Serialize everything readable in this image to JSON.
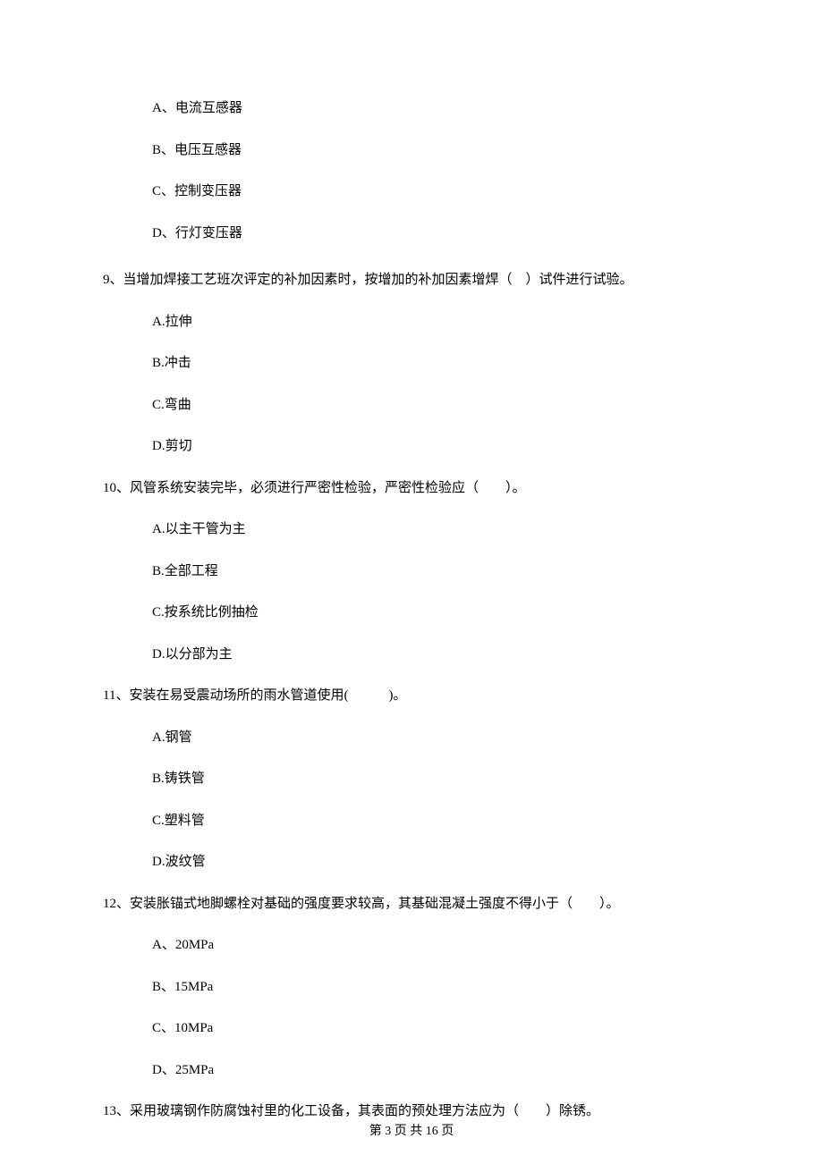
{
  "options_block1": {
    "a": "A、电流互感器",
    "b": "B、电压互感器",
    "c": "C、控制变压器",
    "d": "D、行灯变压器"
  },
  "q9": {
    "text": "9、当增加焊接工艺班次评定的补加因素时，按增加的补加因素增焊（　）试件进行试验。",
    "a": "A.拉伸",
    "b": "B.冲击",
    "c": "C.弯曲",
    "d": "D.剪切"
  },
  "q10": {
    "text": "10、风管系统安装完毕，必须进行严密性检验，严密性检验应（　　）。",
    "a": "A.以主干管为主",
    "b": "B.全部工程",
    "c": "C.按系统比例抽检",
    "d": "D.以分部为主"
  },
  "q11": {
    "text": "11、安装在易受震动场所的雨水管道使用(　　　)。",
    "a": "A.钢管",
    "b": "B.铸铁管",
    "c": "C.塑料管",
    "d": "D.波纹管"
  },
  "q12": {
    "text": "12、安装胀锚式地脚螺栓对基础的强度要求较高，其基础混凝土强度不得小于（　　）。",
    "a": "A、20MPa",
    "b": "B、15MPa",
    "c": "C、10MPa",
    "d": "D、25MPa"
  },
  "q13": {
    "text": "13、采用玻璃钢作防腐蚀衬里的化工设备，其表面的预处理方法应为（　　）除锈。"
  },
  "footer": "第 3 页 共 16 页"
}
